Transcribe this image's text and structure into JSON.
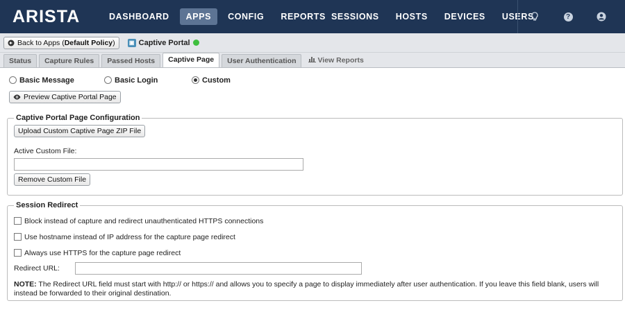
{
  "brand": "ARISTA",
  "nav_left": [
    "DASHBOARD",
    "APPS",
    "CONFIG",
    "REPORTS"
  ],
  "nav_right": [
    "SESSIONS",
    "HOSTS",
    "DEVICES",
    "USERS"
  ],
  "toolbar": {
    "back_prefix": "Back to Apps (",
    "back_policy": "Default Policy",
    "back_suffix": ")",
    "app_title": "Captive Portal"
  },
  "tabs": [
    "Status",
    "Capture Rules",
    "Passed Hosts",
    "Captive Page",
    "User Authentication"
  ],
  "view_reports": "View Reports",
  "radios": [
    "Basic Message",
    "Basic Login",
    "Custom"
  ],
  "preview_label": "Preview Captive Portal Page",
  "config": {
    "legend": "Captive Portal Page Configuration",
    "upload_label": "Upload Custom Captive Page ZIP File",
    "active_file_label": "Active Custom File:",
    "active_file_value": "",
    "remove_label": "Remove Custom File"
  },
  "redirect": {
    "legend": "Session Redirect",
    "checkboxes": [
      "Block instead of capture and redirect unauthenticated HTTPS connections",
      "Use hostname instead of IP address for the capture page redirect",
      "Always use HTTPS for the capture page redirect"
    ],
    "url_label": "Redirect URL:",
    "url_value": "",
    "note_bold": "NOTE:",
    "note_text": " The Redirect URL field must start with http:// or https:// and allows you to specify a page to display immediately after user authentication. If you leave this field blank, users will instead be forwarded to their original destination."
  }
}
